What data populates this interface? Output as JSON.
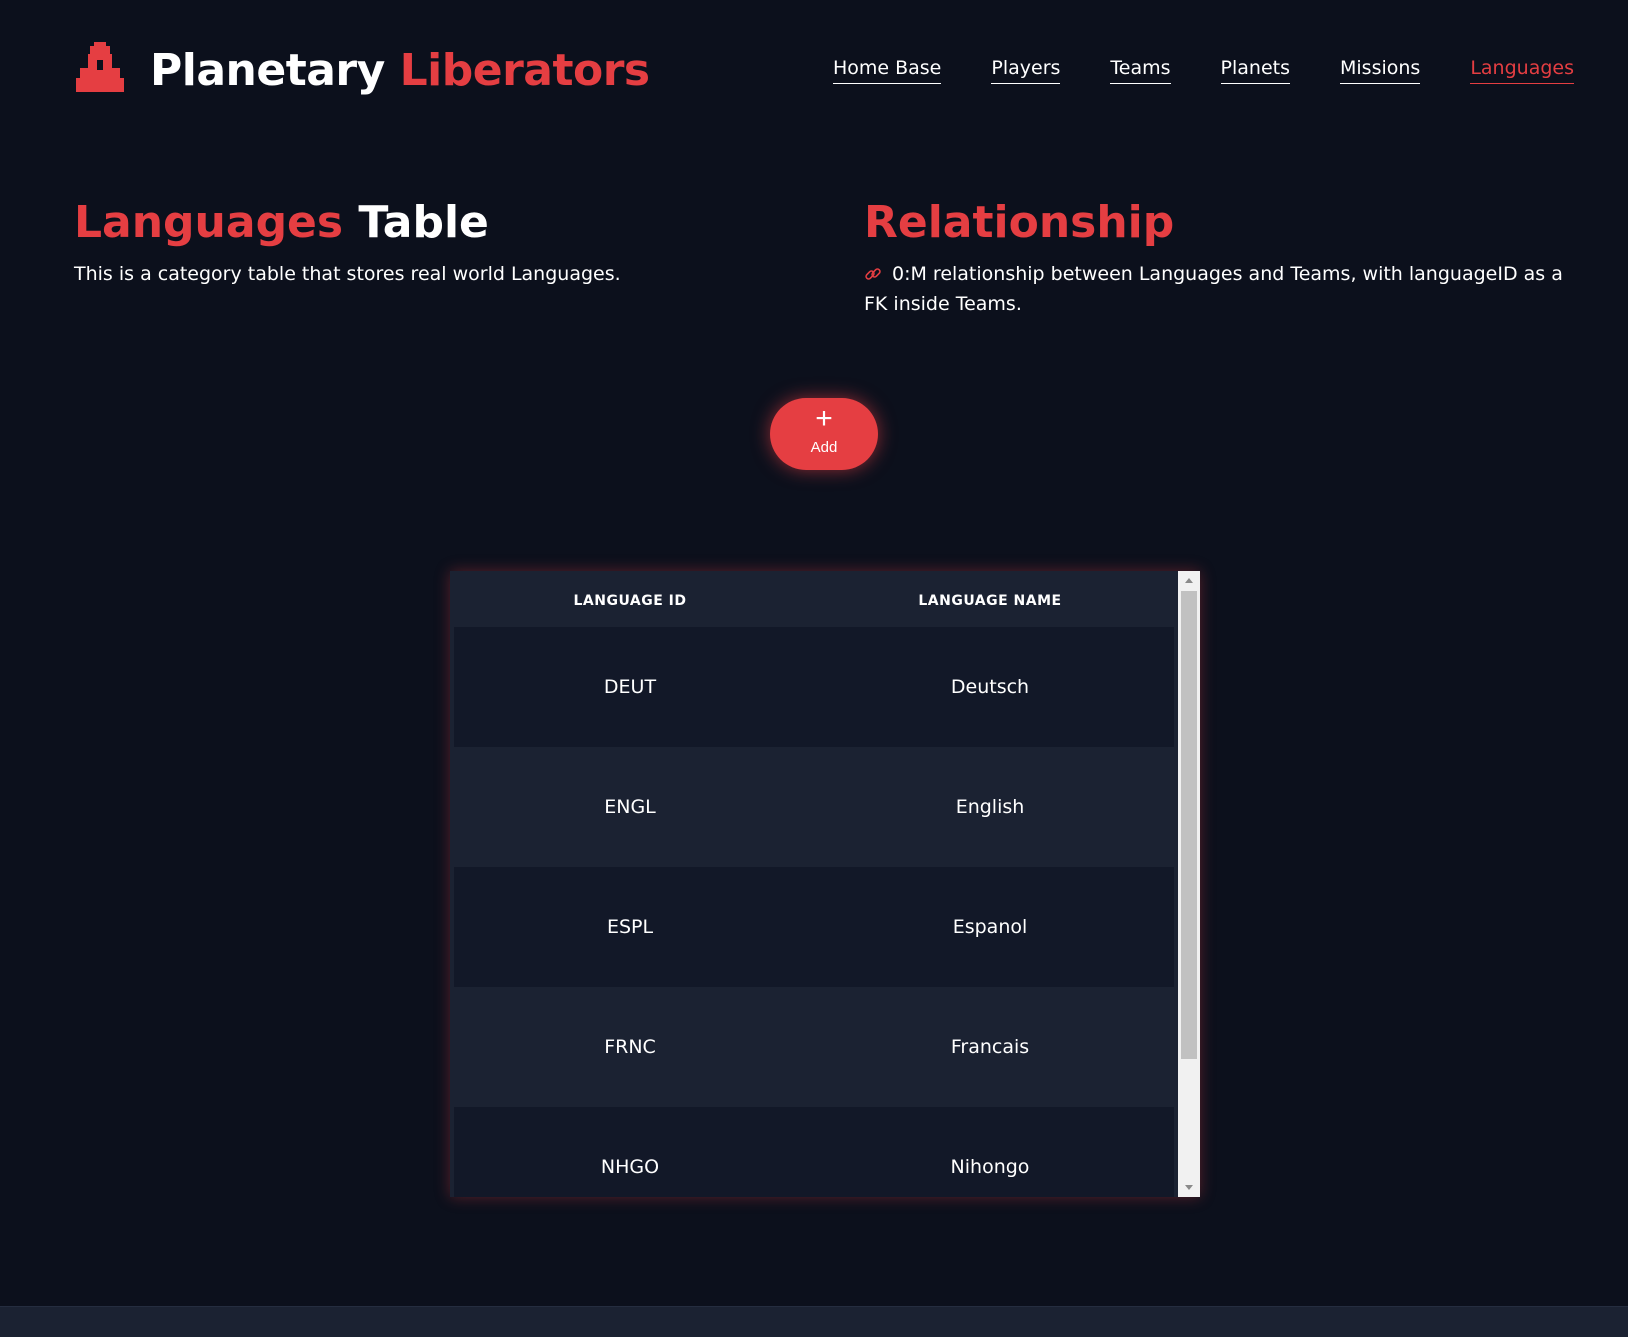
{
  "brand": {
    "title_part1": "Planetary",
    "title_part2": "Liberators",
    "logo_icon": "rocket-icon"
  },
  "nav": {
    "items": [
      {
        "label": "Home Base"
      },
      {
        "label": "Players"
      },
      {
        "label": "Teams"
      },
      {
        "label": "Planets"
      },
      {
        "label": "Missions"
      },
      {
        "label": "Languages"
      }
    ],
    "active": "Languages"
  },
  "intro": {
    "title_accent": "Languages",
    "title_rest": "Table",
    "description": "This is a category table that stores real world Languages."
  },
  "relationship": {
    "title": "Relationship",
    "icon": "link-icon",
    "description": "0:M relationship between Languages and Teams, with languageID as a FK inside Teams."
  },
  "add_button": {
    "icon": "plus-icon",
    "label": "Add"
  },
  "table": {
    "columns": [
      "LANGUAGE ID",
      "LANGUAGE NAME"
    ],
    "rows": [
      {
        "id": "DEUT",
        "name": "Deutsch"
      },
      {
        "id": "ENGL",
        "name": "English"
      },
      {
        "id": "ESPL",
        "name": "Espanol"
      },
      {
        "id": "FRNC",
        "name": "Francais"
      },
      {
        "id": "NHGO",
        "name": "Nihongo"
      }
    ]
  },
  "colors": {
    "accent": "#e53e42",
    "background": "#0c101c",
    "row_dark": "#121828",
    "row_light": "#1b2232"
  }
}
